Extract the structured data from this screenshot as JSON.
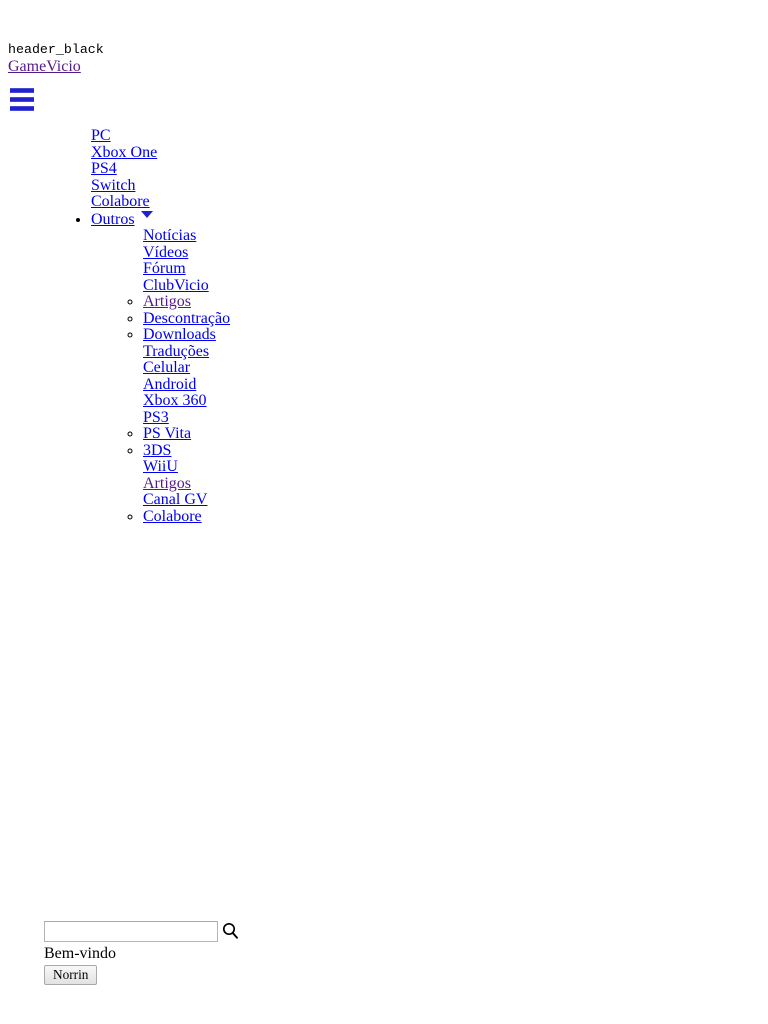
{
  "header": {
    "debug_label": "header_black",
    "brand": "GameVicio",
    "menu_icon": "hamburger-icon"
  },
  "nav": {
    "primary": [
      {
        "label": "PC",
        "bulleted": false,
        "visited": false
      },
      {
        "label": "Xbox One",
        "bulleted": false,
        "visited": false
      },
      {
        "label": "PS4",
        "bulleted": false,
        "visited": false
      },
      {
        "label": "Switch",
        "bulleted": false,
        "visited": false
      },
      {
        "label": "Colabore",
        "bulleted": false,
        "visited": false
      }
    ],
    "dropdown": {
      "label": "Outros",
      "caret_icon": "chevron-down-icon",
      "bulleted": true,
      "items": [
        {
          "label": "Notícias",
          "bulleted": false,
          "visited": false
        },
        {
          "label": "Vídeos",
          "bulleted": false,
          "visited": false
        },
        {
          "label": "Fórum",
          "bulleted": false,
          "visited": false
        },
        {
          "label": "ClubVicio",
          "bulleted": false,
          "visited": false
        },
        {
          "label": "Artigos",
          "bulleted": true,
          "visited": true
        },
        {
          "label": "Descontração",
          "bulleted": true,
          "visited": false
        },
        {
          "label": "Downloads",
          "bulleted": true,
          "visited": false
        },
        {
          "label": "Traduções",
          "bulleted": false,
          "visited": false
        },
        {
          "label": "Celular",
          "bulleted": false,
          "visited": false
        },
        {
          "label": "Android",
          "bulleted": false,
          "visited": false
        },
        {
          "label": "Xbox 360",
          "bulleted": false,
          "visited": false
        },
        {
          "label": "PS3",
          "bulleted": false,
          "visited": false
        },
        {
          "label": "PS Vita",
          "bulleted": true,
          "visited": false
        },
        {
          "label": "3DS",
          "bulleted": true,
          "visited": false
        },
        {
          "label": "WiiU",
          "bulleted": false,
          "visited": false
        },
        {
          "label": "Artigos",
          "bulleted": false,
          "visited": true
        },
        {
          "label": "Canal GV",
          "bulleted": false,
          "visited": false
        },
        {
          "label": "Colabore",
          "bulleted": true,
          "visited": false
        }
      ]
    }
  },
  "search": {
    "value": "",
    "placeholder": "",
    "icon": "search-icon"
  },
  "account": {
    "greeting": "Bem-vindo",
    "username_button": "Norrin"
  },
  "colors": {
    "link": "#0000ee",
    "visited_link": "#551a8b",
    "text": "#000000",
    "accent": "#2222cc",
    "page_background": "#ffffff"
  }
}
